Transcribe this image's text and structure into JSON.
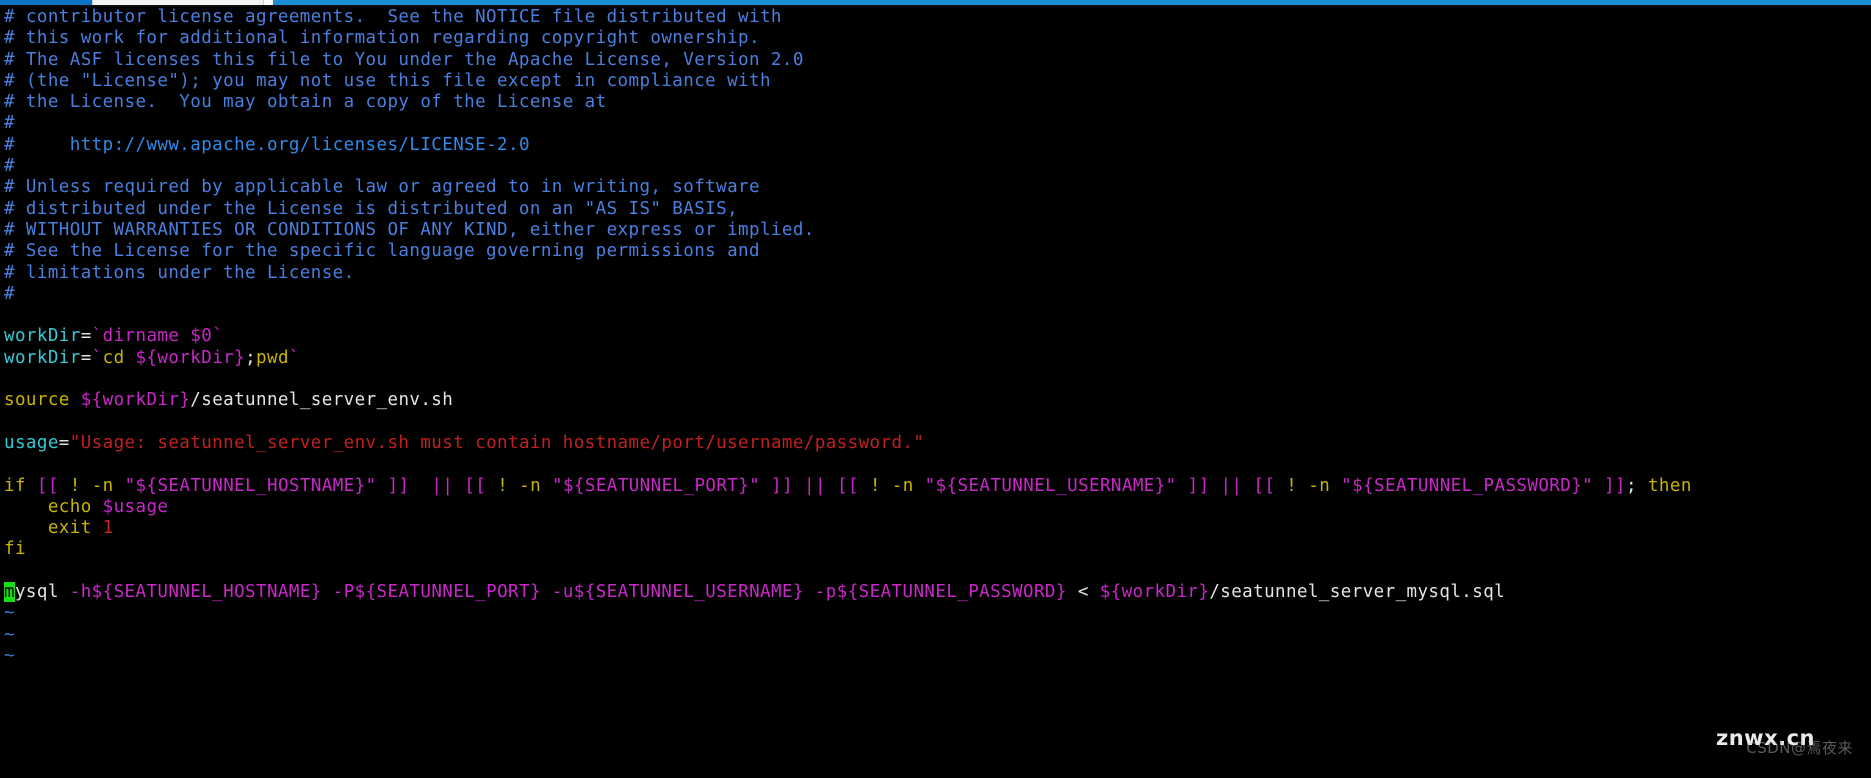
{
  "window": {
    "type": "terminal-vim-editor",
    "background": "#000000",
    "top_strip": {
      "accent_color": "#1a8fd8",
      "tab_active_color": "#0b73c4"
    }
  },
  "editor": {
    "mode": "normal",
    "cursor": {
      "char": "m",
      "line": 24,
      "column": 1,
      "color": "#18e018"
    },
    "colors": {
      "comment": "#4a7fe0",
      "url": "#2f8ae8",
      "identifier": "#35c9d6",
      "command": "#c9b400",
      "variable": "#c828c8",
      "string": "#c12020",
      "number": "#cc2020",
      "plain": "#e4e4e4",
      "tilde": "#3a7bd5",
      "cursor": "#18e018"
    },
    "lines": [
      {
        "id": 1,
        "segments": [
          {
            "t": "# contributor license agreements.  See the NOTICE file distributed with",
            "c": "comment"
          }
        ]
      },
      {
        "id": 2,
        "segments": [
          {
            "t": "# this work for additional information regarding copyright ownership.",
            "c": "comment"
          }
        ]
      },
      {
        "id": 3,
        "segments": [
          {
            "t": "# The ASF licenses this file to You under the Apache License, Version 2.0",
            "c": "comment"
          }
        ]
      },
      {
        "id": 4,
        "segments": [
          {
            "t": "# (the \"License\"); you may not use this file except in compliance with",
            "c": "comment"
          }
        ]
      },
      {
        "id": 5,
        "segments": [
          {
            "t": "# the License.  You may obtain a copy of the License at",
            "c": "comment"
          }
        ]
      },
      {
        "id": 6,
        "segments": [
          {
            "t": "#",
            "c": "comment"
          }
        ]
      },
      {
        "id": 7,
        "segments": [
          {
            "t": "#     ",
            "c": "comment"
          },
          {
            "t": "http://www.apache.org/licenses/LICENSE-2.0",
            "c": "url"
          }
        ]
      },
      {
        "id": 8,
        "segments": [
          {
            "t": "#",
            "c": "comment"
          }
        ]
      },
      {
        "id": 9,
        "segments": [
          {
            "t": "# Unless required by applicable law or agreed to in writing, software",
            "c": "comment"
          }
        ]
      },
      {
        "id": 10,
        "segments": [
          {
            "t": "# distributed under the License is distributed on an \"AS IS\" BASIS,",
            "c": "comment"
          }
        ]
      },
      {
        "id": 11,
        "segments": [
          {
            "t": "# WITHOUT WARRANTIES OR CONDITIONS OF ANY KIND, either express or implied.",
            "c": "comment"
          }
        ]
      },
      {
        "id": 12,
        "segments": [
          {
            "t": "# See the License for the specific language governing permissions and",
            "c": "comment"
          }
        ]
      },
      {
        "id": 13,
        "segments": [
          {
            "t": "# limitations under the License.",
            "c": "comment"
          }
        ]
      },
      {
        "id": 14,
        "segments": [
          {
            "t": "#",
            "c": "comment"
          }
        ]
      },
      {
        "id": 15,
        "segments": []
      },
      {
        "id": 16,
        "segments": [
          {
            "t": "workDir",
            "c": "ident"
          },
          {
            "t": "=",
            "c": "op"
          },
          {
            "t": "`",
            "c": "var"
          },
          {
            "t": "dirname $0",
            "c": "var"
          },
          {
            "t": "`",
            "c": "var"
          }
        ]
      },
      {
        "id": 17,
        "segments": [
          {
            "t": "workDir",
            "c": "ident"
          },
          {
            "t": "=",
            "c": "op"
          },
          {
            "t": "`",
            "c": "var"
          },
          {
            "t": "cd ",
            "c": "cmd"
          },
          {
            "t": "${workDir}",
            "c": "var"
          },
          {
            "t": ";",
            "c": "op"
          },
          {
            "t": "pwd",
            "c": "cmd"
          },
          {
            "t": "`",
            "c": "var"
          }
        ]
      },
      {
        "id": 18,
        "segments": []
      },
      {
        "id": 19,
        "segments": [
          {
            "t": "source",
            "c": "cmd"
          },
          {
            "t": " ",
            "c": "plain"
          },
          {
            "t": "${workDir}",
            "c": "var"
          },
          {
            "t": "/seatunnel_server_env.sh",
            "c": "plain"
          }
        ]
      },
      {
        "id": 20,
        "segments": []
      },
      {
        "id": 21,
        "segments": [
          {
            "t": "usage",
            "c": "ident"
          },
          {
            "t": "=",
            "c": "op"
          },
          {
            "t": "\"Usage: seatunnel_server_env.sh must contain hostname/port/username/password.\"",
            "c": "string"
          }
        ]
      },
      {
        "id": 22,
        "segments": []
      },
      {
        "id": 23,
        "segments": [
          {
            "t": "if ",
            "c": "cmd"
          },
          {
            "t": "[[",
            "c": "var"
          },
          {
            "t": " ",
            "c": "plain"
          },
          {
            "t": "!",
            "c": "cmd"
          },
          {
            "t": " ",
            "c": "plain"
          },
          {
            "t": "-n",
            "c": "cmd"
          },
          {
            "t": " ",
            "c": "plain"
          },
          {
            "t": "\"${SEATUNNEL_HOSTNAME}\"",
            "c": "var"
          },
          {
            "t": " ",
            "c": "plain"
          },
          {
            "t": "]]",
            "c": "var"
          },
          {
            "t": "  ",
            "c": "plain"
          },
          {
            "t": "||",
            "c": "var"
          },
          {
            "t": " ",
            "c": "plain"
          },
          {
            "t": "[[",
            "c": "var"
          },
          {
            "t": " ",
            "c": "plain"
          },
          {
            "t": "!",
            "c": "cmd"
          },
          {
            "t": " ",
            "c": "plain"
          },
          {
            "t": "-n",
            "c": "cmd"
          },
          {
            "t": " ",
            "c": "plain"
          },
          {
            "t": "\"${SEATUNNEL_PORT}\"",
            "c": "var"
          },
          {
            "t": " ",
            "c": "plain"
          },
          {
            "t": "]]",
            "c": "var"
          },
          {
            "t": " ",
            "c": "plain"
          },
          {
            "t": "||",
            "c": "var"
          },
          {
            "t": " ",
            "c": "plain"
          },
          {
            "t": "[[",
            "c": "var"
          },
          {
            "t": " ",
            "c": "plain"
          },
          {
            "t": "!",
            "c": "cmd"
          },
          {
            "t": " ",
            "c": "plain"
          },
          {
            "t": "-n",
            "c": "cmd"
          },
          {
            "t": " ",
            "c": "plain"
          },
          {
            "t": "\"${SEATUNNEL_USERNAME}\"",
            "c": "var"
          },
          {
            "t": " ",
            "c": "plain"
          },
          {
            "t": "]]",
            "c": "var"
          },
          {
            "t": " ",
            "c": "plain"
          },
          {
            "t": "||",
            "c": "var"
          },
          {
            "t": " ",
            "c": "plain"
          },
          {
            "t": "[[",
            "c": "var"
          },
          {
            "t": " ",
            "c": "plain"
          },
          {
            "t": "!",
            "c": "cmd"
          },
          {
            "t": " ",
            "c": "plain"
          },
          {
            "t": "-n",
            "c": "cmd"
          },
          {
            "t": " ",
            "c": "plain"
          },
          {
            "t": "\"${SEATUNNEL_PASSWORD}\"",
            "c": "var"
          },
          {
            "t": " ",
            "c": "plain"
          },
          {
            "t": "]]",
            "c": "var"
          },
          {
            "t": ";",
            "c": "op"
          },
          {
            "t": " ",
            "c": "plain"
          },
          {
            "t": "then",
            "c": "cmd"
          }
        ]
      },
      {
        "id": 24,
        "segments": [
          {
            "t": "    ",
            "c": "plain"
          },
          {
            "t": "echo",
            "c": "cmd"
          },
          {
            "t": " ",
            "c": "plain"
          },
          {
            "t": "$usage",
            "c": "var"
          }
        ]
      },
      {
        "id": 25,
        "segments": [
          {
            "t": "    ",
            "c": "plain"
          },
          {
            "t": "exit",
            "c": "cmd"
          },
          {
            "t": " ",
            "c": "plain"
          },
          {
            "t": "1",
            "c": "num"
          }
        ]
      },
      {
        "id": 26,
        "segments": [
          {
            "t": "fi",
            "c": "cmd"
          }
        ]
      },
      {
        "id": 27,
        "segments": []
      },
      {
        "id": 28,
        "segments": [
          {
            "t": "m",
            "c": "cursor"
          },
          {
            "t": "ysql",
            "c": "plain"
          },
          {
            "t": " ",
            "c": "plain"
          },
          {
            "t": "-h${SEATUNNEL_HOSTNAME}",
            "c": "var"
          },
          {
            "t": " ",
            "c": "plain"
          },
          {
            "t": "-P${SEATUNNEL_PORT}",
            "c": "var"
          },
          {
            "t": " ",
            "c": "plain"
          },
          {
            "t": "-u${SEATUNNEL_USERNAME}",
            "c": "var"
          },
          {
            "t": " ",
            "c": "plain"
          },
          {
            "t": "-p${SEATUNNEL_PASSWORD}",
            "c": "var"
          },
          {
            "t": " ",
            "c": "plain"
          },
          {
            "t": "<",
            "c": "op"
          },
          {
            "t": " ",
            "c": "plain"
          },
          {
            "t": "${workDir}",
            "c": "var"
          },
          {
            "t": "/seatunnel_server_mysql.sql",
            "c": "plain"
          }
        ]
      },
      {
        "id": 29,
        "segments": [
          {
            "t": "~",
            "c": "tilde"
          }
        ]
      },
      {
        "id": 30,
        "segments": [
          {
            "t": "~",
            "c": "tilde"
          }
        ]
      },
      {
        "id": 31,
        "segments": [
          {
            "t": "~",
            "c": "tilde"
          }
        ]
      }
    ]
  },
  "watermark": {
    "primary": "znwx.cn",
    "secondary": "CSDN@焉夜来"
  }
}
